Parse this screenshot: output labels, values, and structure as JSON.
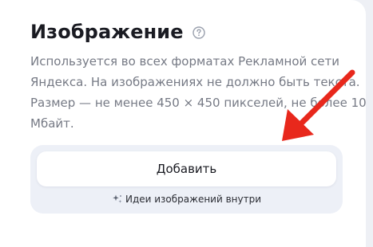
{
  "section": {
    "title": "Изображение",
    "description_lines": [
      "Используется во всех форматах Рекламной сети",
      "Яндекса. На изображениях не должно быть текста.",
      "Размер — не менее 450 × 450 пикселей, не более 10",
      "Мбайт."
    ]
  },
  "upload": {
    "add_label": "Добавить",
    "ideas_label": "Идеи изображений внутри"
  },
  "icons": {
    "help": "help-circle-icon",
    "ideas": "sparkle-icon",
    "annotation": "red-arrow-icon"
  },
  "colors": {
    "title": "#1a1b22",
    "description": "#767a85",
    "upload_zone": "#edf0f7",
    "arrow": "#e8281c"
  }
}
